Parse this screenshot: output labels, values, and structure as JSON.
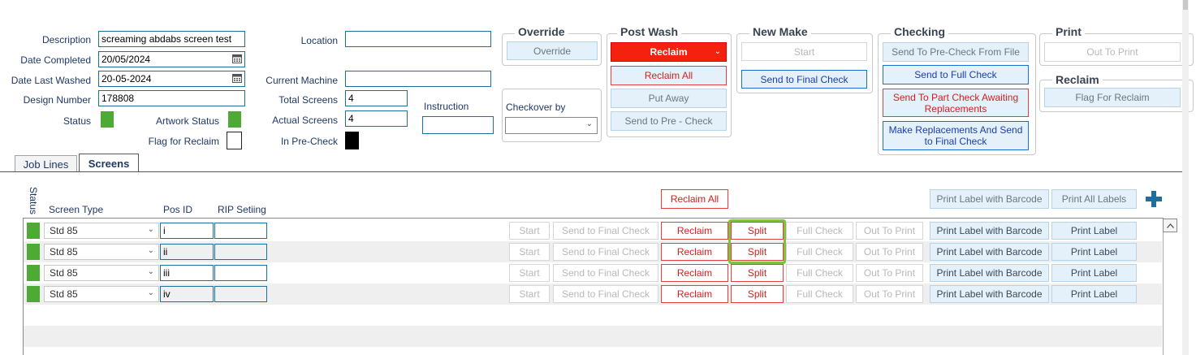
{
  "form": {
    "description_label": "Description",
    "description_value": "screaming abdabs screen test",
    "date_completed_label": "Date Completed",
    "date_completed_value": "20/05/2024",
    "date_last_washed_label": "Date Last Washed",
    "date_last_washed_value": "20-05-2024",
    "design_number_label": "Design Number",
    "design_number_value": "178808",
    "status_label": "Status",
    "artwork_status_label": "Artwork Status",
    "flag_for_reclaim_label": "Flag for Reclaim",
    "location_label": "Location",
    "location_value": "",
    "current_machine_label": "Current Machine",
    "current_machine_value": "",
    "total_screens_label": "Total Screens",
    "total_screens_value": "4",
    "actual_screens_label": "Actual Screens",
    "actual_screens_value": "4",
    "in_precheck_label": "In Pre-Check",
    "instruction_label": "Instruction",
    "instruction_value": "",
    "checkover_label": "Checkover by",
    "checkover_value": ""
  },
  "override": {
    "title": "Override",
    "button": "Override"
  },
  "post_wash": {
    "title": "Post Wash",
    "dropdown": "Reclaim",
    "reclaim_all": "Reclaim All",
    "put_away": "Put Away",
    "send_precheck": "Send to Pre - Check"
  },
  "new_make": {
    "title": "New Make",
    "start": "Start",
    "send_final": "Send to Final Check"
  },
  "checking": {
    "title": "Checking",
    "send_precheck_file": "Send To Pre-Check From File",
    "send_full": "Send to Full Check",
    "send_part": "Send To Part Check Awaiting Replacements",
    "make_replacements": "Make Replacements And Send to Final Check"
  },
  "print": {
    "title": "Print",
    "out_to_print": "Out To Print"
  },
  "reclaim": {
    "title": "Reclaim",
    "flag": "Flag For Reclaim"
  },
  "tabs": [
    {
      "label": "Job Lines",
      "active": false
    },
    {
      "label": "Screens",
      "active": true
    }
  ],
  "grid": {
    "status_header": "Status",
    "screen_type_header": "Screen Type",
    "pos_id_header": "Pos ID",
    "rip_header": "RIP Setiing",
    "reclaim_all": "Reclaim All",
    "print_label_barcode": "Print Label with Barcode",
    "print_all_labels": "Print All Labels",
    "row_buttons": {
      "start": "Start",
      "send_final": "Send to Final Check",
      "reclaim": "Reclaim",
      "split": "Split",
      "full_check": "Full Check",
      "out_to_print": "Out To Print",
      "print_label_barcode": "Print Label with Barcode",
      "print_label": "Print Label"
    },
    "rows": [
      {
        "screen_type": "Std 85",
        "pos_id": "i",
        "rip": ""
      },
      {
        "screen_type": "Std 85",
        "pos_id": "ii",
        "rip": ""
      },
      {
        "screen_type": "Std 85",
        "pos_id": "iii",
        "rip": ""
      },
      {
        "screen_type": "Std 85",
        "pos_id": "iv",
        "rip": ""
      }
    ]
  },
  "colors": {
    "status_green": "#4caa35",
    "accent_red": "#f5210f",
    "add_button": "#1e6f9a",
    "highlight": "#7dc242"
  }
}
